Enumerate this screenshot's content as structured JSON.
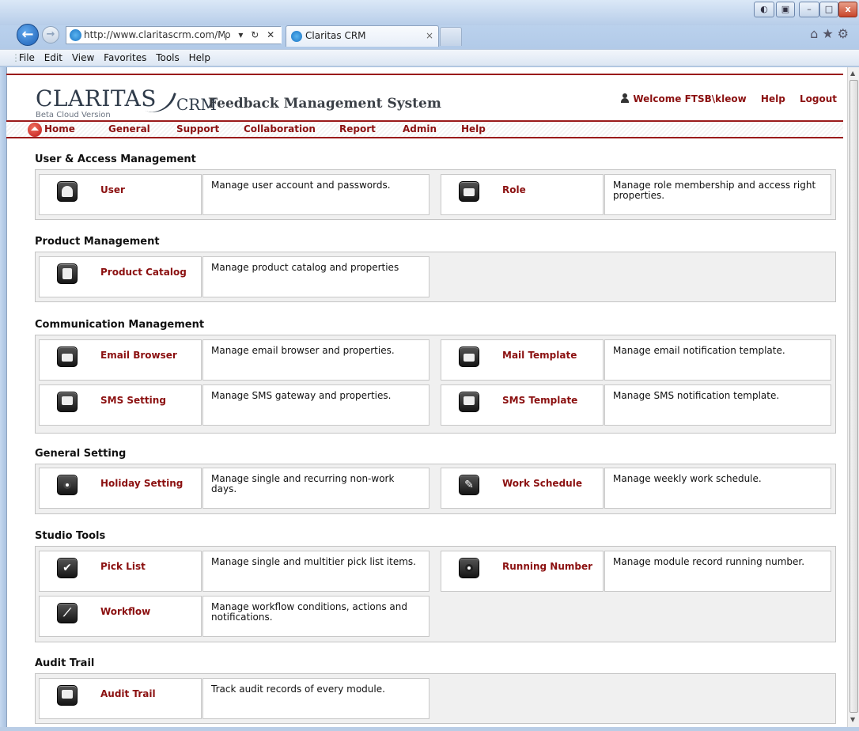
{
  "browser": {
    "url": "http://www.claritascrm.com/Mair",
    "tab_title": "Claritas CRM",
    "tab_close": "×",
    "back_glyph": "←",
    "forward_glyph": "→",
    "address_tools": "ρ ▾ ↻ ✕",
    "toolbar_icons": "⌂★⚙",
    "window_buttons": {
      "minimize": "–",
      "maximize": "□",
      "close": "x",
      "compat": "◐",
      "extra": "▣"
    },
    "menu": [
      "File",
      "Edit",
      "View",
      "Favorites",
      "Tools",
      "Help"
    ]
  },
  "header": {
    "brand": "CLARITAS",
    "brand_suffix": "CRM",
    "beta": "Beta Cloud Version",
    "system_name": "Feedback Management System",
    "welcome": "Welcome FTSB\\kleow",
    "help": "Help",
    "logout": "Logout"
  },
  "nav": [
    "Home",
    "General",
    "Support",
    "Collaboration",
    "Report",
    "Admin",
    "Help"
  ],
  "sections": [
    {
      "title": "User & Access Management",
      "items": [
        {
          "label": "User",
          "desc": "Manage user account and passwords.",
          "icon": "user-icon"
        },
        {
          "label": "Role",
          "desc": "Manage role membership and access right properties.",
          "icon": "briefcase-icon"
        }
      ]
    },
    {
      "title": "Product Management",
      "items": [
        {
          "label": "Product Catalog",
          "desc": "Manage product catalog and properties",
          "icon": "catalog-icon"
        }
      ]
    },
    {
      "title": "Communication Management",
      "items": [
        {
          "label": "Email Browser",
          "desc": "Manage email browser and properties.",
          "icon": "envelope-icon"
        },
        {
          "label": "Mail Template",
          "desc": "Manage email notification template.",
          "icon": "envelope-icon"
        },
        {
          "label": "SMS Setting",
          "desc": "Manage SMS gateway and properties.",
          "icon": "chat-icon"
        },
        {
          "label": "SMS Template",
          "desc": "Manage SMS notification template.",
          "icon": "chat-icon"
        }
      ]
    },
    {
      "title": "General Setting",
      "items": [
        {
          "label": "Holiday Setting",
          "desc": "Manage single and recurring non-work days.",
          "icon": "camera-icon"
        },
        {
          "label": "Work Schedule",
          "desc": "Manage weekly work schedule.",
          "icon": "pencil-icon"
        }
      ]
    },
    {
      "title": "Studio Tools",
      "items": [
        {
          "label": "Pick List",
          "desc": "Manage single and multitier pick list items.",
          "icon": "checkmark-icon"
        },
        {
          "label": "Running Number",
          "desc": "Manage module record running number.",
          "icon": "record-icon"
        },
        {
          "label": "Workflow",
          "desc": "Manage workflow conditions, actions and notifications.",
          "icon": "chart-icon"
        }
      ]
    },
    {
      "title": "Audit Trail",
      "items": [
        {
          "label": "Audit Trail",
          "desc": "Track audit records of every module.",
          "icon": "document-icon"
        }
      ]
    }
  ],
  "colors": {
    "accent": "#8b1010",
    "rule": "#9a1a1a",
    "panel": "#f0f0f0"
  }
}
